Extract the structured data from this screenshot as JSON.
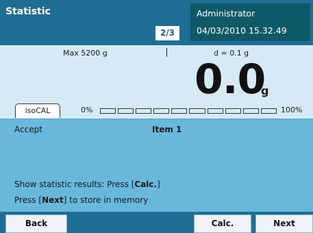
{
  "header": {
    "title": "Statistic",
    "page_indicator": "2/3",
    "user": "Administrator",
    "datetime": "04/03/2010 15.32.49"
  },
  "display": {
    "max": "Max 5200 g",
    "d": "d = 0.1 g",
    "weight": "0.0",
    "unit": "g",
    "isocal": "isoCAL",
    "progress_min": "0%",
    "progress_max": "100%",
    "progress_segments": 10,
    "progress_value": 0
  },
  "info": {
    "accept": "Accept",
    "item": "Item 1",
    "msg1_prefix": "Show statistic results: Press [",
    "msg1_key": "Calc.",
    "msg1_suffix": "]",
    "msg2_prefix": "Press [",
    "msg2_key": "Next",
    "msg2_suffix": "] to store in memory"
  },
  "footer": {
    "back": "Back",
    "calc": "Calc.",
    "next": "Next"
  },
  "colors": {
    "header": "#1f6e93",
    "user_box": "#0d5a66",
    "display_bg": "#d6eaf5",
    "info_bg": "#68b8dc"
  }
}
